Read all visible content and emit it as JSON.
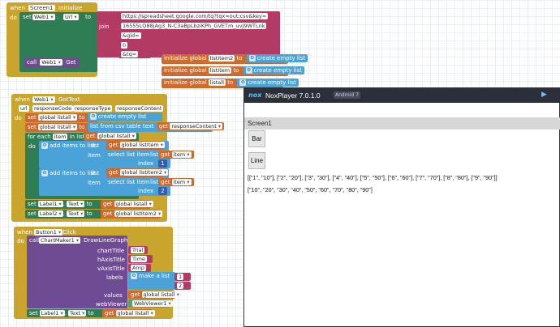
{
  "init_event": {
    "when": "when",
    "component": "Screen1",
    "event": "Initialize",
    "do": "do"
  },
  "set_uri": {
    "set": "set",
    "component": "Web1",
    "property": "Url",
    "to": "to"
  },
  "join": {
    "label": "join",
    "parts": [
      "https://spreadsheet.google.com/tq?tqx=out:csv&key=",
      "16555LQ88jAg3_N-C3aBpLbziKPh_GVETm_uvJ9WTLnk",
      "&gid=",
      "0",
      "&tq="
    ]
  },
  "call_get": {
    "call": "call",
    "component": "Web1",
    "method": "Get"
  },
  "globals": [
    {
      "init": "initialize global",
      "name": "listItem2",
      "to": "to",
      "value": "create empty list"
    },
    {
      "init": "initialize global",
      "name": "listItem",
      "to": "to",
      "value": "create empty list"
    },
    {
      "init": "initialize global",
      "name": "listall",
      "to": "to",
      "value": "create empty list"
    }
  ],
  "gottext": {
    "when": "when",
    "component": "Web1",
    "event": "GotText",
    "params": [
      "url",
      "responseCode",
      "responseType",
      "responseContent"
    ],
    "do": "do"
  },
  "gt_set1": {
    "set": "set",
    "var": "global listall",
    "to": "to",
    "value": "create empty list"
  },
  "gt_set2": {
    "set": "set",
    "var": "global listall",
    "to": "to",
    "fn": "list from csv table",
    "text": "text",
    "get": "get",
    "arg": "responseContent"
  },
  "foreach": {
    "label": "for each",
    "item": "item",
    "in": "in list",
    "get": "get",
    "list": "global listall"
  },
  "add1": {
    "label": "add items to list",
    "list_lbl": "list",
    "get": "get",
    "list": "global listItem",
    "item_lbl": "item",
    "select": "select list item",
    "list2": "list",
    "get2": "get",
    "arg": "item",
    "index_lbl": "index",
    "index": "1"
  },
  "add2": {
    "label": "add items to list",
    "list_lbl": "list",
    "get": "get",
    "list": "global listItem2",
    "item_lbl": "item",
    "select": "select list item",
    "list2": "list",
    "get2": "get",
    "arg": "item",
    "index_lbl": "index",
    "index": "2"
  },
  "set_label1": {
    "set": "set",
    "component": "Label1",
    "prop": "Text",
    "to": "to",
    "get": "get",
    "var": "global listall"
  },
  "set_label2": {
    "set": "set",
    "component": "Label2",
    "prop": "Text",
    "to": "to",
    "get": "get",
    "var": "global listItem2"
  },
  "click": {
    "when": "when",
    "component": "Button1",
    "event": "Click",
    "do": "do"
  },
  "draw": {
    "call": "call",
    "component": "ChartMaker1",
    "method": "DrawLineGraph",
    "chartTitle_lbl": "chartTitle",
    "chartTitle": "Trial",
    "hAxis_lbl": "hAxisTitle",
    "hAxis": "Time",
    "vAxis_lbl": "vAxisTitle",
    "vAxis": "Amp",
    "labels_lbl": "labels",
    "make_list": "make a list",
    "l1": "1",
    "l2": "2",
    "values_lbl": "values",
    "values_get": "get",
    "values_var": "global listall",
    "webviewer_lbl": "webViewer",
    "webviewer": "WebViewer1"
  },
  "set_label1b": {
    "set": "set",
    "component": "Label1",
    "prop": "Text",
    "to": "to",
    "get": "get",
    "var": "global listall"
  },
  "nox": {
    "logo": "nox",
    "title": "NoxPlayer 7.0.1.0",
    "android": "Android 7",
    "screen": "Screen1",
    "bar": "Bar",
    "line": "Line",
    "label1": "[[\"1\", \"10\"], [\"2\", \"20\"], [\"3\", \"30\"], [\"4\", \"40\"], [\"5\", \"50\"], [\"6\", \"60\"], [\"7\", \"70\"], [\"8\", \"80\"], [\"9\", \"90\"]]",
    "label2": "[\"10\", \"20\", \"30\", \"40\", \"50\", \"60\", \"70\", \"80\", \"90\"]"
  },
  "colors": {
    "event": "#c9a52d",
    "component": "#2e7d54",
    "variable": "#cf6a2c",
    "text": "#b23a63",
    "procedure": "#6f4b94",
    "list": "#4aa3d8"
  }
}
